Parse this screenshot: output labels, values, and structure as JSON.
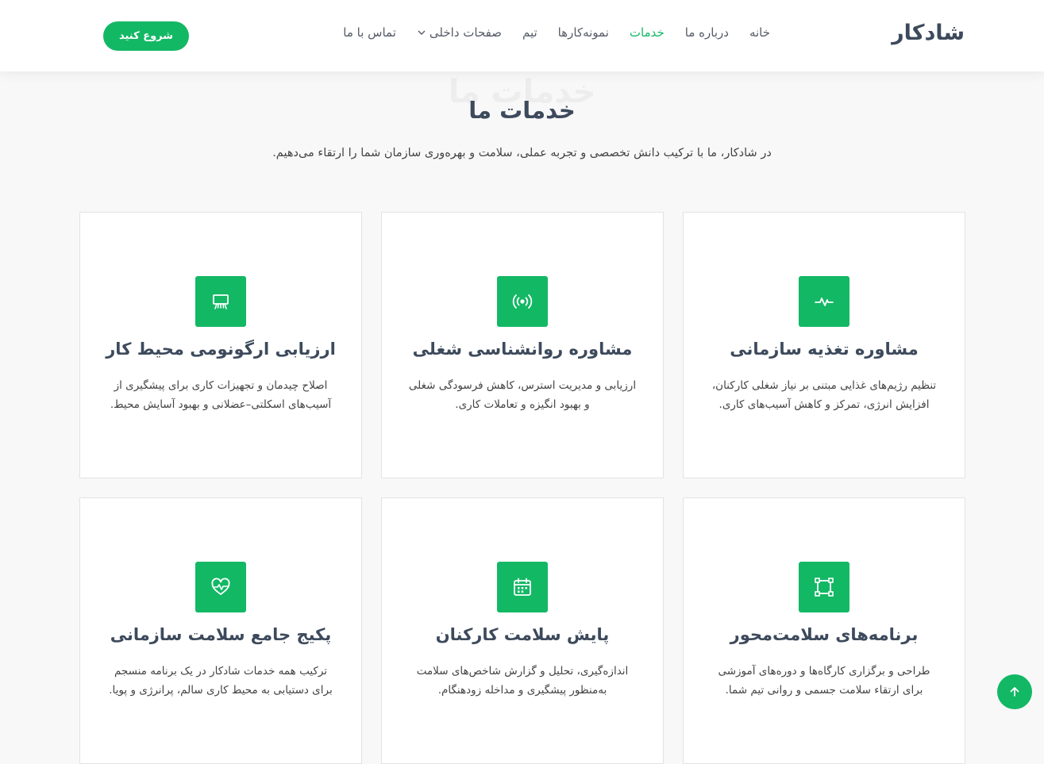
{
  "header": {
    "logo": "شادکار",
    "nav": [
      {
        "label": "خانه",
        "active": false
      },
      {
        "label": "درباره ما",
        "active": false
      },
      {
        "label": "خدمات",
        "active": true
      },
      {
        "label": "نمونه‌کارها",
        "active": false
      },
      {
        "label": "تیم",
        "active": false
      },
      {
        "label": "صفحات داخلی",
        "active": false,
        "dropdown": true
      },
      {
        "label": "تماس با ما",
        "active": false
      }
    ],
    "cta_label": "شروع کنید"
  },
  "section": {
    "title_bg": "خدمات ما",
    "title": "خدمات ما",
    "subtitle": "در شادکار، ما با ترکیب دانش تخصصی و تجربه عملی، سلامت و بهره‌وری سازمان شما را ارتقاء می‌دهیم."
  },
  "services": [
    {
      "title": "مشاوره تغذیه سازمانی",
      "desc": "تنظیم رژیم‌های غذایی مبتنی بر نیاز شغلی کارکنان، افزایش انرژی، تمرکز و کاهش آسیب‌های کاری.",
      "icon": "activity-icon"
    },
    {
      "title": "مشاوره روانشناسی شغلی",
      "desc": "ارزیابی و مدیریت استرس، کاهش فرسودگی شغلی و بهبود انگیزه و تعاملات کاری.",
      "icon": "broadcast-icon"
    },
    {
      "title": "ارزیابی ارگونومی محیط کار",
      "desc": "اصلاح چیدمان و تجهیزات کاری برای پیشگیری از آسیب‌های اسکلتی–عضلانی و بهبود آسایش محیط.",
      "icon": "easel-icon"
    },
    {
      "title": "برنامه‌های سلامت‌محور",
      "desc": "طراحی و برگزاری کارگاه‌ها و دوره‌های آموزشی برای ارتقاء سلامت جسمی و روانی تیم شما.",
      "icon": "bounding-box-icon"
    },
    {
      "title": "پایش سلامت کارکنان",
      "desc": "اندازه‌گیری، تحلیل و گزارش شاخص‌های سلامت به‌منظور پیشگیری و مداخله زودهنگام.",
      "icon": "calendar-icon"
    },
    {
      "title": "پکیج جامع سلامت سازمانی",
      "desc": "ترکیب همه خدمات شادکار در یک برنامه منسجم برای دستیابی به محیط کاری سالم، پرانرژی و پویا.",
      "icon": "heart-pulse-icon"
    }
  ],
  "colors": {
    "accent": "#13b865",
    "heading": "#3d4a5c"
  },
  "back_to_top_icon": "arrow-up-icon"
}
